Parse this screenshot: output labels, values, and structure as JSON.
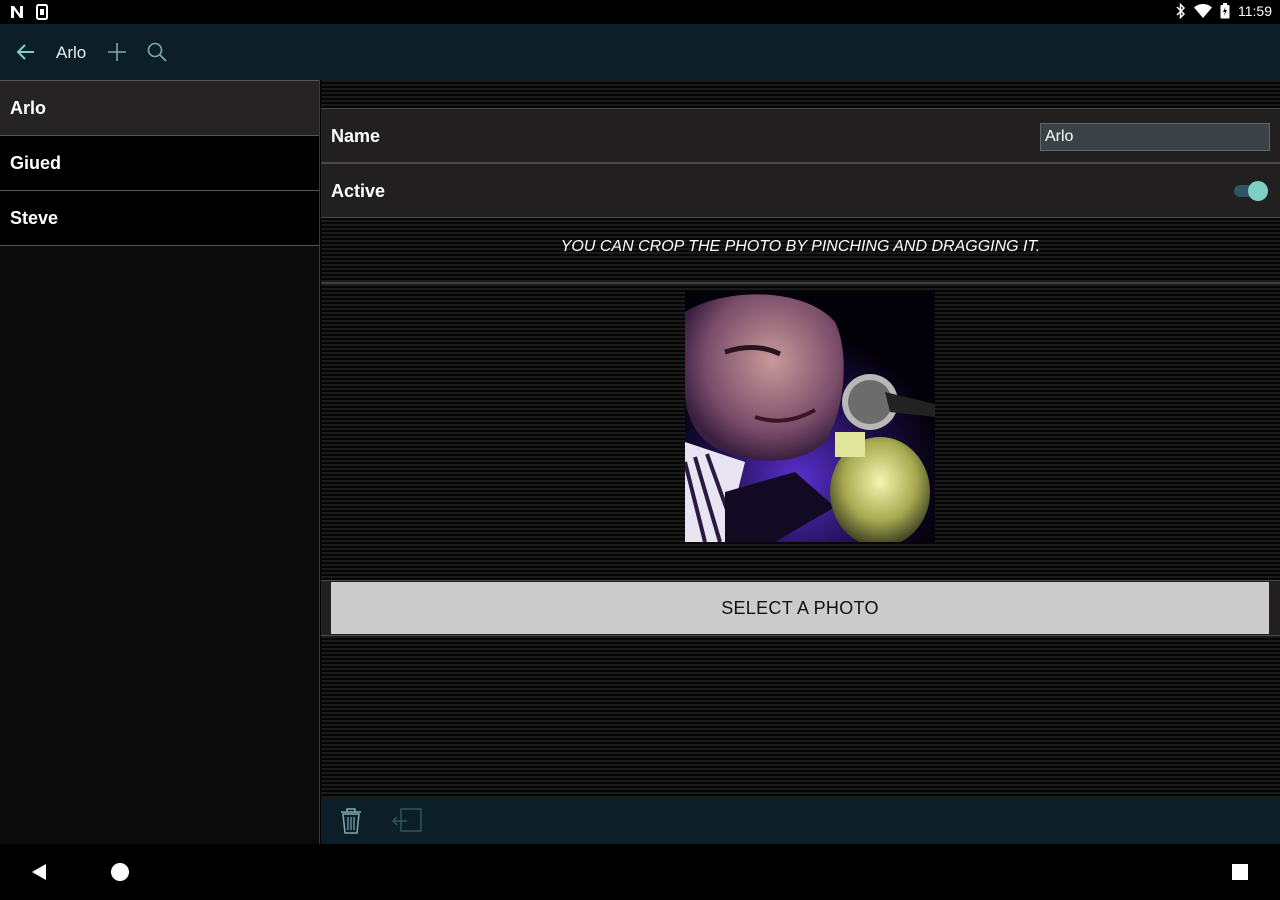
{
  "status_bar": {
    "time": "11:59"
  },
  "app_bar": {
    "title": "Arlo"
  },
  "sidebar": {
    "items": [
      {
        "label": "Arlo",
        "selected": true
      },
      {
        "label": "Giued",
        "selected": false
      },
      {
        "label": "Steve",
        "selected": false
      }
    ]
  },
  "form": {
    "name_label": "Name",
    "name_value": "Arlo",
    "active_label": "Active",
    "active_on": true,
    "crop_hint": "YOU CAN CROP THE PHOTO BY PINCHING AND DRAGGING IT.",
    "select_photo_label": "SELECT A PHOTO"
  },
  "colors": {
    "accent": "#7fd0c4",
    "app_bar": "#0c1f29"
  }
}
